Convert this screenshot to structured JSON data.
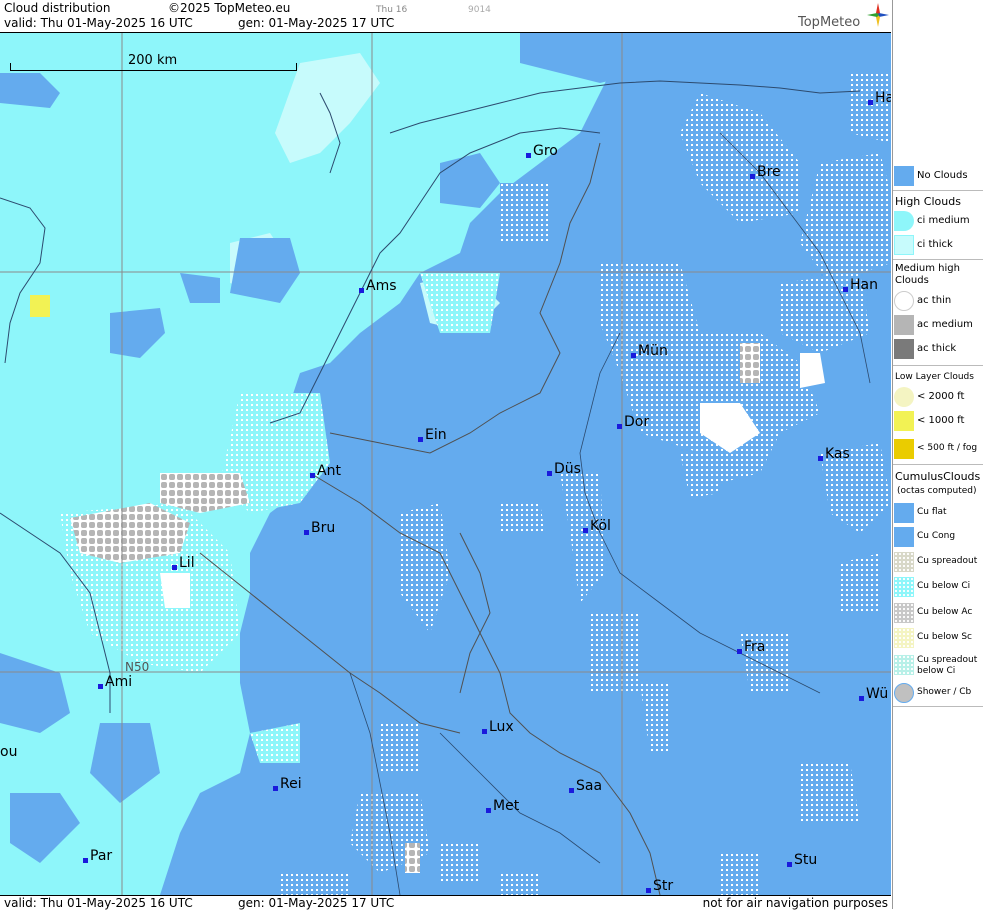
{
  "header": {
    "title": "Cloud distribution",
    "copyright": "©2025 TopMeteo.eu",
    "valid": "valid:  Thu  01-May-2025  16 UTC",
    "gen": "gen: 01-May-2025 17 UTC",
    "day": "Thu 16",
    "code": "9014",
    "brand": "TopMeteo"
  },
  "footer": {
    "valid": "valid:  Thu  01-May-2025  16 UTC",
    "gen": "gen: 01-May-2025 17 UTC",
    "note": "not for air navigation purposes"
  },
  "map": {
    "scale_label": "200 km",
    "lat_label": "N50",
    "cities": [
      "Ha",
      "Gro",
      "Bre",
      "Ams",
      "Han",
      "Mün",
      "Ein",
      "Dor",
      "Kas",
      "Ant",
      "Düs",
      "Bru",
      "Köl",
      "Lil",
      "Fra",
      "Ami",
      "Wü",
      "Lux",
      "ou",
      "Rei",
      "Saa",
      "Met",
      "Par",
      "Stu",
      "Str"
    ]
  },
  "legend": {
    "no_clouds": "No Clouds",
    "high_clouds": "High Clouds",
    "ci_medium": "ci medium",
    "ci_thick": "ci thick",
    "medium_high_clouds": "Medium high Clouds",
    "ac_thin": "ac thin",
    "ac_medium": "ac medium",
    "ac_thick": "ac thick",
    "low_layer_clouds": "Low Layer Clouds",
    "lt2000": "< 2000 ft",
    "lt1000": "< 1000 ft",
    "lt500": "< 500 ft / fog",
    "cumulus_clouds": "CumulusClouds",
    "octas": "(octas computed)",
    "cu_flat": "Cu flat",
    "cu_cong": "Cu Cong",
    "cu_spreadout": "Cu spreadout",
    "cu_below_ci": "Cu below Ci",
    "cu_below_ac": "Cu below Ac",
    "cu_below_sc": "Cu below Sc",
    "cu_spreadout_below_ci": "Cu spreadout below Ci",
    "shower_cb": "Shower / Cb"
  },
  "colors": {
    "no_clouds": "#64abee",
    "ci_medium": "#8ef6fa",
    "ci_thick": "#c7fbfc",
    "lt2000": "#f4f4c2",
    "lt1000": "#f2f254",
    "lt500": "#eacc00",
    "ac_medium": "#b5b5b5",
    "ac_thick": "#7a7a7a"
  }
}
